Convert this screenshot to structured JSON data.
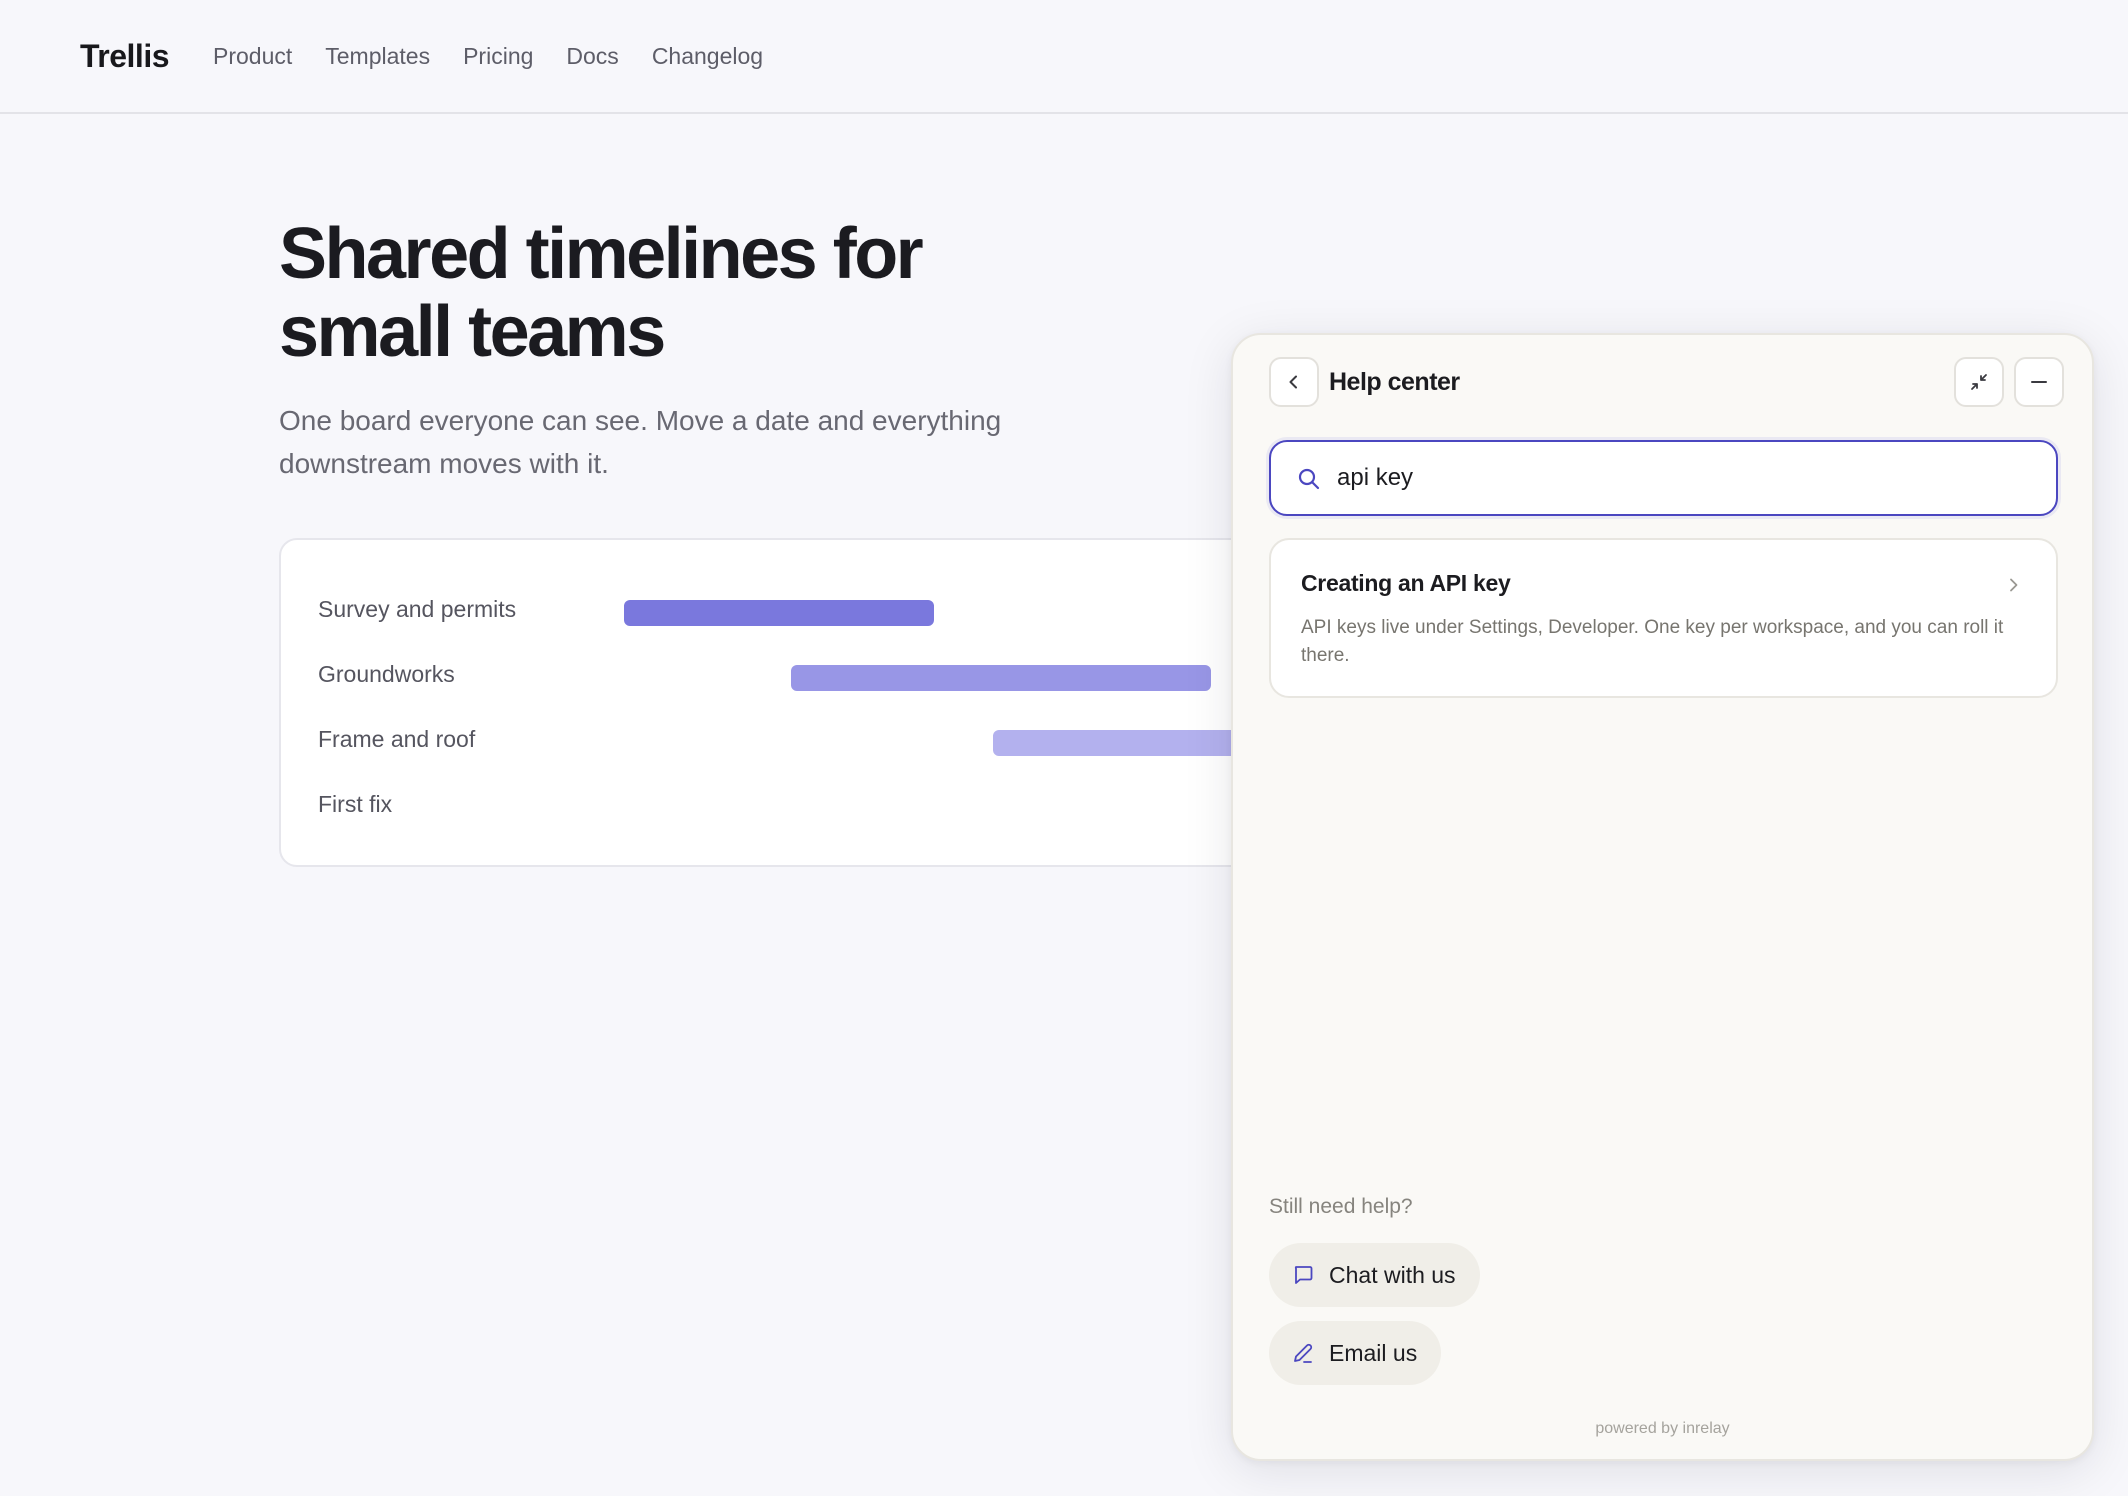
{
  "brand": {
    "logo_text": "Trellis"
  },
  "nav": {
    "items": [
      {
        "label": "Product"
      },
      {
        "label": "Templates"
      },
      {
        "label": "Pricing"
      },
      {
        "label": "Docs"
      },
      {
        "label": "Changelog"
      }
    ]
  },
  "hero": {
    "title_line1": "Shared timelines for",
    "title_line2": "small teams",
    "subtitle_line1": "One board everyone can see. Move a date and everything",
    "subtitle_line2": "downstream moves with it."
  },
  "timeline": {
    "rows": [
      {
        "label": "Survey and permits",
        "bar_color": "#7a78dd"
      },
      {
        "label": "Groundworks",
        "bar_color": "#9896e6"
      },
      {
        "label": "Frame and roof",
        "bar_color": "#b3b1ee"
      },
      {
        "label": "First fix"
      }
    ]
  },
  "help_center": {
    "title": "Help center",
    "back_icon": "chevron-left-icon",
    "collapse_icon": "collapse-arrows-icon",
    "minimize_icon": "minus-icon",
    "search": {
      "value": "api key",
      "icon": "search-icon"
    },
    "results": [
      {
        "title": "Creating an API key",
        "description": "API keys live under Settings, Developer. One key per workspace, and you can roll it there."
      }
    ],
    "still_need_help": "Still need help?",
    "chat_button": {
      "label": "Chat with us",
      "icon": "chat-bubble-icon"
    },
    "email_button": {
      "label": "Email us",
      "icon": "pencil-icon"
    },
    "powered_by": "powered by inrelay",
    "accent_color": "#4b47c0"
  }
}
